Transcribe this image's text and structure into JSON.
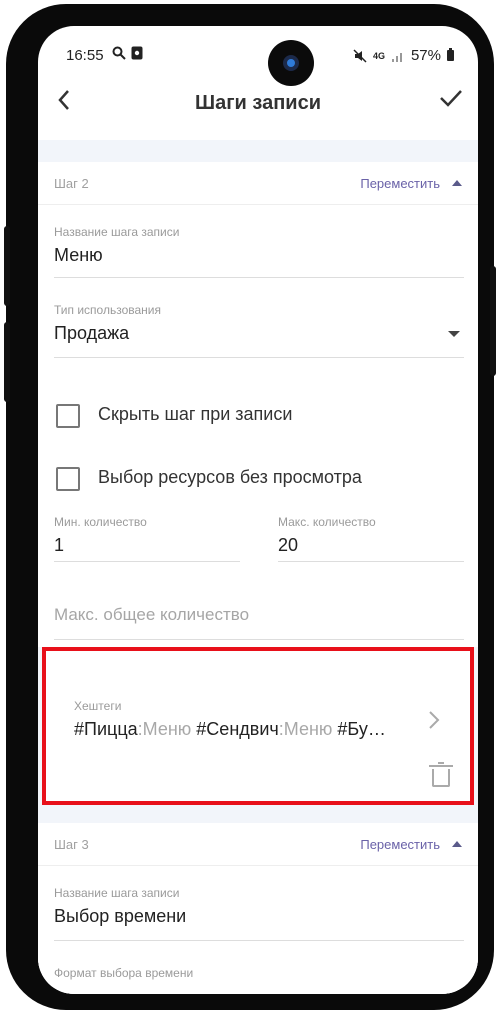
{
  "status_bar": {
    "time": "16:55",
    "battery": "57%",
    "network": "4G"
  },
  "app_bar": {
    "title": "Шаги записи",
    "back_icon": "chevron-left-icon",
    "confirm_icon": "check-icon"
  },
  "step2": {
    "label": "Шаг 2",
    "move_label": "Переместить",
    "name_label": "Название шага записи",
    "name_value": "Меню",
    "usage_label": "Тип использования",
    "usage_value": "Продажа",
    "hide_step_label": "Скрыть шаг при записи",
    "resource_select_label": "Выбор ресурсов без просмотра",
    "min_label": "Мин. количество",
    "min_value": "1",
    "max_label": "Макс. количество",
    "max_value": "20",
    "max_total_placeholder": "Макс. общее количество",
    "hashtags_label": "Хештеги",
    "hashtags": [
      {
        "tag": "#Пицца",
        "cat": ":Меню"
      },
      {
        "tag": " #Сендвич",
        "cat": ":Меню"
      },
      {
        "tag": " #Бу…",
        "cat": ""
      }
    ]
  },
  "step3": {
    "label": "Шаг 3",
    "move_label": "Переместить",
    "name_label": "Название шага записи",
    "name_value": "Выбор времени",
    "time_format_label": "Формат выбора времени"
  },
  "colors": {
    "accent": "#6a62a8",
    "highlight": "#e8101a"
  }
}
